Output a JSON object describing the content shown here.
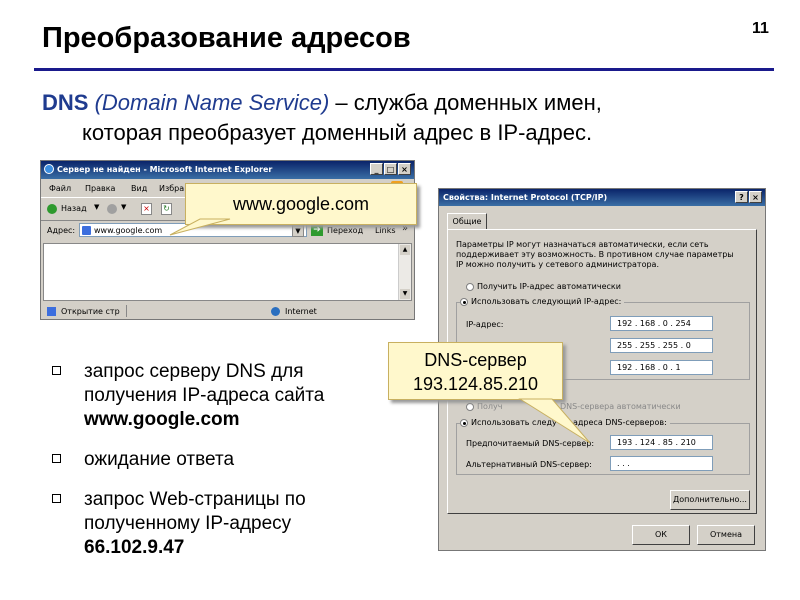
{
  "slide": {
    "title": "Преобразование адресов",
    "number": "11",
    "intro_kw": "DNS",
    "intro_kw_full": "(Domain Name Service)",
    "intro_rest": " – служба доменных имен,",
    "intro_line2": "которая преобразует доменный адрес в IP-адрес."
  },
  "ie": {
    "title": "Сервер не найден - Microsoft Internet Explorer",
    "menu": [
      "Файл",
      "Правка",
      "Вид",
      "Избра"
    ],
    "back_label": "Назад",
    "address_label": "Адрес:",
    "address_value": "www.google.com",
    "go_label": "Переход",
    "links_label": "Links",
    "status_text": "Открытие стр",
    "status_zone": "Internet",
    "win_buttons": [
      "_",
      "□",
      "×"
    ],
    "chevron": "»"
  },
  "callouts": {
    "google": "www.google.com",
    "dns_line1": "DNS-сервер",
    "dns_line2": "193.124.85.210"
  },
  "bullets": [
    {
      "text": "запрос серверу DNS для получения IP-адреса сайта ",
      "bold": "www.google.com"
    },
    {
      "text": "ожидание ответа",
      "bold": ""
    },
    {
      "text": "запрос Web-страницы по полученному IP-адресу ",
      "bold": "66.102.9.47"
    }
  ],
  "dialog": {
    "title": "Свойства: Internet Protocol (TCP/IP)",
    "title_buttons": [
      "?",
      "×"
    ],
    "tab": "Общие",
    "info_line1": "Параметры IP могут назначаться автоматически, если сеть",
    "info_line2": "поддерживает эту возможность. В противном случае параметры",
    "info_line3": "IP можно получить у сетевого администратора.",
    "radio_auto_ip": "Получить IP-адрес автоматически",
    "radio_manual_ip": "Использовать следующий IP-адрес:",
    "ip_label": "IP-адрес:",
    "ip_value": "192 . 168 .  0  . 254",
    "mask_value": "255 . 255 . 255 .  0",
    "gateway_value": "192 . 168 .  0  .  1",
    "radio_auto_dns": "Получить адрес DNS-сервера автоматически",
    "radio_auto_dns_visible": "Получ",
    "radio_auto_dns_tail": "DNS-сервера автоматически",
    "radio_manual_dns": "Использовать следу",
    "radio_manual_dns_tail": "адреса DNS-серверов:",
    "pref_dns_label": "Предпочитаемый DNS-сервер:",
    "pref_dns_value": "193 . 124 . 85 . 210",
    "alt_dns_label": "Альтернативный DNS-сервер:",
    "alt_dns_value": " .       .       .",
    "advanced_label": "Дополнительно...",
    "ok_label": "ОК",
    "cancel_label": "Отмена"
  }
}
